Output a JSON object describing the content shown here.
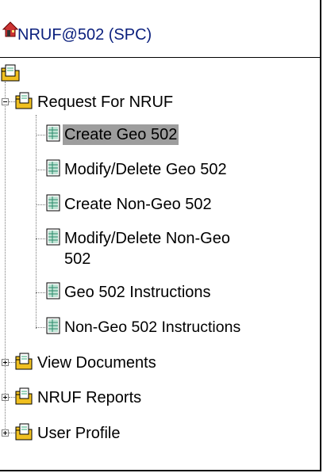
{
  "header": {
    "title": "NRUF@502 (SPC)"
  },
  "tree": {
    "request_folder": "Request For NRUF",
    "request_items": [
      "Create Geo 502",
      "Modify/Delete Geo 502",
      "Create Non-Geo 502",
      "Modify/Delete Non-Geo 502",
      "Geo 502 Instructions",
      "Non-Geo 502 Instructions"
    ],
    "selected_index": 0,
    "other_folders": [
      "View Documents",
      "NRUF Reports",
      "User Profile"
    ]
  },
  "icons": {
    "home": "home-icon",
    "folder": "folder-icon",
    "document": "document-icon"
  },
  "colors": {
    "header_text": "#0a1f7d",
    "selected_bg": "#9d9d9d",
    "folder": "#f0c020"
  }
}
